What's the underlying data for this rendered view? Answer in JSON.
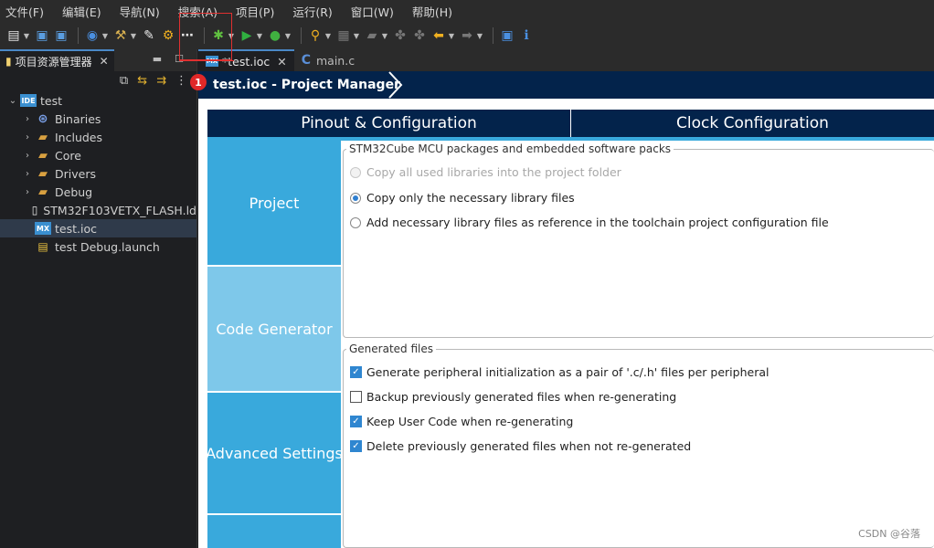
{
  "menu": [
    "文件(F)",
    "编辑(E)",
    "导航(N)",
    "搜索(A)",
    "项目(P)",
    "运行(R)",
    "窗口(W)",
    "帮助(H)"
  ],
  "toolbar": {
    "icons": [
      "new-icon",
      "save-icon",
      "save-all-icon",
      "navigate-icon",
      "build-icon",
      "properties-icon",
      "device-config-tool-icon",
      "link-icon",
      "debug-icon",
      "run-icon",
      "external-tools-icon",
      "search-icon",
      "annotation-icon",
      "task-icon",
      "prev-edit-icon",
      "next-edit-icon",
      "back-arrow-icon",
      "forward-arrow-icon",
      "perspective-icon",
      "info-icon"
    ]
  },
  "explorer": {
    "tab_label": "项目资源管理器",
    "tree": [
      {
        "label": "test",
        "icon": "IDE",
        "level": 0,
        "expanded": true
      },
      {
        "label": "Binaries",
        "icon": "binaries",
        "level": 1
      },
      {
        "label": "Includes",
        "icon": "includes",
        "level": 1
      },
      {
        "label": "Core",
        "icon": "folder",
        "level": 1
      },
      {
        "label": "Drivers",
        "icon": "folder",
        "level": 1
      },
      {
        "label": "Debug",
        "icon": "folder",
        "level": 1
      },
      {
        "label": "STM32F103VETX_FLASH.ld",
        "icon": "file",
        "level": 1
      },
      {
        "label": "test.ioc",
        "icon": "MX",
        "level": 1,
        "selected": true
      },
      {
        "label": "test Debug.launch",
        "icon": "launch",
        "level": 1
      }
    ]
  },
  "editor_tabs": [
    {
      "label": "*test.ioc",
      "icon": "MX",
      "active": true
    },
    {
      "label": "main.c",
      "icon": "C",
      "active": false
    }
  ],
  "header": {
    "title": "test.ioc - Project Manager"
  },
  "big_tabs": [
    "Pinout & Configuration",
    "Clock Configuration"
  ],
  "side_nav": {
    "project": "Project",
    "code_generator": "Code Generator",
    "advanced": "Advanced Settings"
  },
  "group1": {
    "legend": "STM32Cube MCU packages and embedded software packs",
    "options": [
      {
        "label": "Copy all used libraries into the project folder",
        "selected": false,
        "disabled": true
      },
      {
        "label": "Copy only the necessary library files",
        "selected": true,
        "disabled": false
      },
      {
        "label": "Add necessary library files as reference in the toolchain project configuration file",
        "selected": false,
        "disabled": false
      }
    ]
  },
  "group2": {
    "legend": "Generated files",
    "options": [
      {
        "label": "Generate peripheral initialization as a pair of '.c/.h' files per peripheral",
        "checked": true
      },
      {
        "label": "Backup previously generated files when re-generating",
        "checked": false
      },
      {
        "label": "Keep User Code when re-generating",
        "checked": true
      },
      {
        "label": "Delete previously generated files when not re-generated",
        "checked": true
      }
    ]
  },
  "annotation": {
    "badge": "1"
  },
  "watermark": "CSDN @谷落",
  "colors": {
    "header_navy": "#03234b",
    "accent_blue": "#39a9dc",
    "selected_nav": "#7ec8ea",
    "annotation_red": "#e02828"
  }
}
